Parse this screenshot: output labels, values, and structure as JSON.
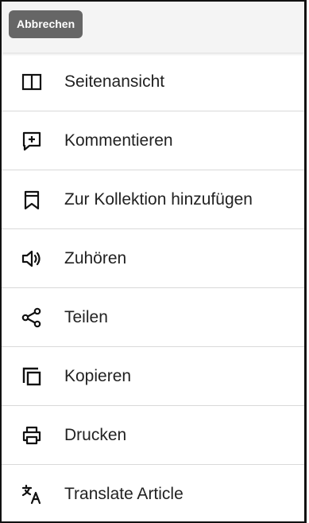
{
  "cancel_button": "Abbrechen",
  "menu": {
    "items": [
      {
        "label": "Seitenansicht",
        "icon": "split-view-icon"
      },
      {
        "label": "Kommentieren",
        "icon": "add-comment-icon"
      },
      {
        "label": "Zur Kollektion hinzufügen",
        "icon": "bookmark-icon"
      },
      {
        "label": "Zuhören",
        "icon": "speaker-icon"
      },
      {
        "label": "Teilen",
        "icon": "share-icon"
      },
      {
        "label": "Kopieren",
        "icon": "copy-icon"
      },
      {
        "label": "Drucken",
        "icon": "printer-icon"
      },
      {
        "label": "Translate Article",
        "icon": "translate-icon"
      }
    ]
  },
  "colors": {
    "cancel_bg": "#666666",
    "text": "#222222",
    "divider": "#d9d9d9",
    "topbar_bg": "#f4f4f4"
  }
}
